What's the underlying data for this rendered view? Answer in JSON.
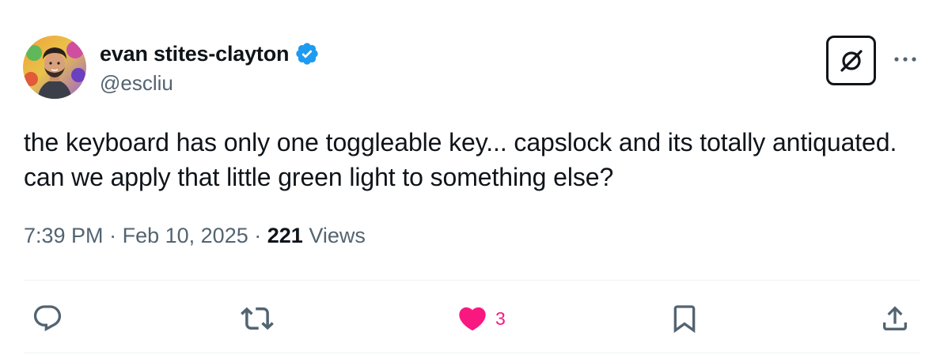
{
  "author": {
    "display_name": "evan stites-clayton",
    "handle": "@escliu",
    "verified": true,
    "avatar_icon": "profile-photo"
  },
  "tweet": {
    "text": "the keyboard has only one toggleable key... capslock and its totally antiquated. can we apply that little green light to something else?"
  },
  "meta": {
    "time": "7:39 PM",
    "separator": "·",
    "date": "Feb 10, 2025",
    "views_count": "221",
    "views_label": "Views"
  },
  "header_actions": {
    "grok_icon": "grok-icon",
    "more_icon": "more-horizontal-icon"
  },
  "actions": {
    "reply": {
      "icon": "reply-icon",
      "count": ""
    },
    "retweet": {
      "icon": "retweet-icon",
      "count": ""
    },
    "like": {
      "icon": "heart-filled-icon",
      "count": "3",
      "color": "#f91880"
    },
    "bookmark": {
      "icon": "bookmark-icon",
      "count": ""
    },
    "share": {
      "icon": "share-icon",
      "count": ""
    }
  },
  "colors": {
    "text_primary": "#0f1419",
    "text_secondary": "#536471",
    "verified_blue": "#1d9bf0",
    "like_pink": "#f91880",
    "divider": "#eff3f4"
  }
}
